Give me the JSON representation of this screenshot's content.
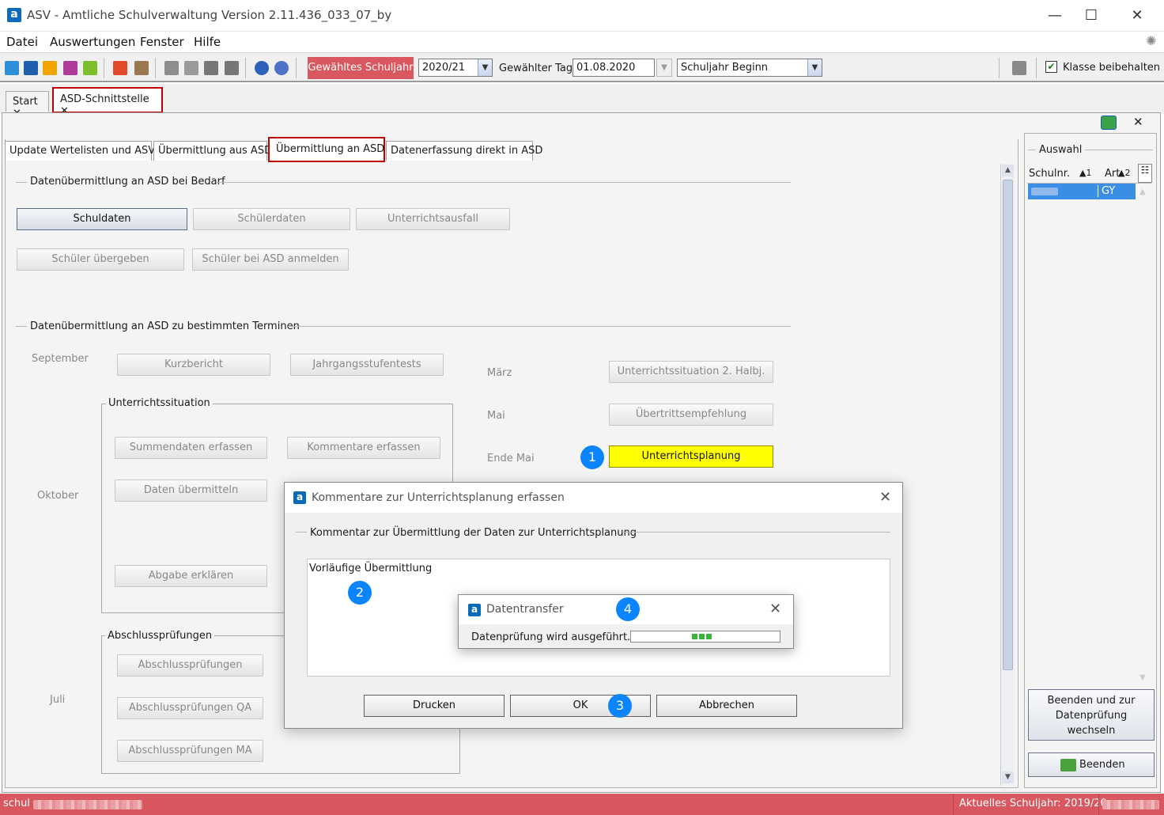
{
  "window": {
    "title": "ASV - Amtliche Schulverwaltung Version 2.11.436_033_07_by",
    "min": "—",
    "max": "☐",
    "close": "✕",
    "app_icon": "a"
  },
  "menu": [
    "Datei",
    "Auswertungen",
    "Fenster",
    "Hilfe"
  ],
  "toolbar": {
    "schuljahr_label": "Gewähltes Schuljahr",
    "schuljahr_value": "2020/21",
    "tag_label": "Gewählter Tag",
    "tag_value": "01.08.2020",
    "mode_value": "Schuljahr Beginn",
    "klasse_label": "Klasse beibehalten",
    "accent_color": "#d9575e"
  },
  "doc_tabs": [
    {
      "label": "Start",
      "close": "✕"
    },
    {
      "label": "ASD-Schnittstelle",
      "close": "✕"
    }
  ],
  "sub_tabs": [
    "Update Wertelisten und ASV",
    "Übermittlung aus ASD",
    "Übermittlung an ASD",
    "Datenerfassung direkt in ASD"
  ],
  "main": {
    "section1_title": "Datenübermittlung an ASD bei Bedarf",
    "buttons1": [
      "Schuldaten",
      "Schülerdaten",
      "Unterrichtsausfall"
    ],
    "buttons2": [
      "Schüler übergeben",
      "Schüler bei ASD anmelden"
    ],
    "section2_title": "Datenübermittlung an ASD zu bestimmten Terminen",
    "september": "September",
    "kurzbericht": "Kurzbericht",
    "jahrgang": "Jahrgangsstufentests",
    "unterricht_group": "Unterrichtssituation",
    "summendaten": "Summendaten erfassen",
    "kommentare": "Kommentare erfassen",
    "daten_uebermitteln": "Daten übermitteln",
    "abgabe": "Abgabe erklären",
    "oktober": "Oktober",
    "abschluss_group": "Abschlussprüfungen",
    "abschluss_btns": [
      "Abschlussprüfungen",
      "Abschlussprüfungen QA",
      "Abschlussprüfungen MA"
    ],
    "juli": "Juli",
    "maerz": "März",
    "mai": "Mai",
    "ende_mai": "Ende Mai",
    "uhj2": "Unterrichtssituation 2. Halbj.",
    "uebertritt": "Übertrittsempfehlung",
    "unterrichtsplanung": "Unterrichtsplanung",
    "highlight_color": "#ffff00"
  },
  "right_panel": {
    "group": "Auswahl",
    "col1": "Schulnr.",
    "col1_sort": "▲1",
    "col2": "Art",
    "col2_sort": "▲2",
    "row_art": "GY",
    "btn_pruefung": "Beenden und zur Datenprüfung wechseln",
    "btn_beenden": "Beenden",
    "close": "✕"
  },
  "dialog": {
    "title": "Kommentare zur Unterrichtsplanung erfassen",
    "group": "Kommentar zur Übermittlung der Daten zur Unterrichtsplanung",
    "text": "Vorläufige Übermittlung",
    "drucken": "Drucken",
    "ok": "OK",
    "abbrechen": "Abbrechen",
    "close": "✕"
  },
  "progress": {
    "title": "Datentransfer",
    "text": "Datenprüfung wird ausgeführt...",
    "close": "✕"
  },
  "badges": [
    "1",
    "2",
    "3",
    "4"
  ],
  "status": {
    "left": "schul",
    "right": "Aktuelles Schuljahr: 2019/20"
  }
}
